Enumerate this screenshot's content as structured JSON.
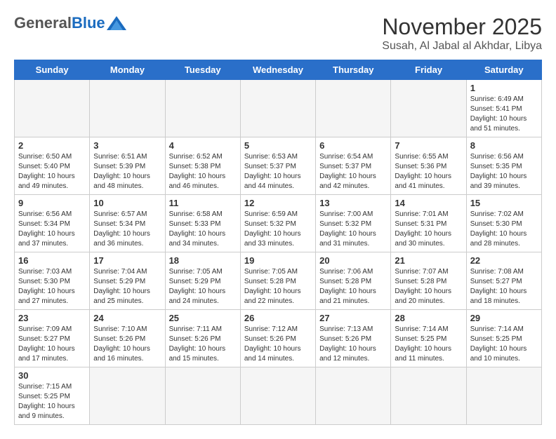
{
  "header": {
    "logo_general": "General",
    "logo_blue": "Blue",
    "month_title": "November 2025",
    "location": "Susah, Al Jabal al Akhdar, Libya"
  },
  "weekdays": [
    "Sunday",
    "Monday",
    "Tuesday",
    "Wednesday",
    "Thursday",
    "Friday",
    "Saturday"
  ],
  "days": [
    {
      "date": 1,
      "sunrise": "6:49 AM",
      "sunset": "5:41 PM",
      "daylight": "10 hours and 51 minutes."
    },
    {
      "date": 2,
      "sunrise": "6:50 AM",
      "sunset": "5:40 PM",
      "daylight": "10 hours and 49 minutes."
    },
    {
      "date": 3,
      "sunrise": "6:51 AM",
      "sunset": "5:39 PM",
      "daylight": "10 hours and 48 minutes."
    },
    {
      "date": 4,
      "sunrise": "6:52 AM",
      "sunset": "5:38 PM",
      "daylight": "10 hours and 46 minutes."
    },
    {
      "date": 5,
      "sunrise": "6:53 AM",
      "sunset": "5:37 PM",
      "daylight": "10 hours and 44 minutes."
    },
    {
      "date": 6,
      "sunrise": "6:54 AM",
      "sunset": "5:37 PM",
      "daylight": "10 hours and 42 minutes."
    },
    {
      "date": 7,
      "sunrise": "6:55 AM",
      "sunset": "5:36 PM",
      "daylight": "10 hours and 41 minutes."
    },
    {
      "date": 8,
      "sunrise": "6:56 AM",
      "sunset": "5:35 PM",
      "daylight": "10 hours and 39 minutes."
    },
    {
      "date": 9,
      "sunrise": "6:56 AM",
      "sunset": "5:34 PM",
      "daylight": "10 hours and 37 minutes."
    },
    {
      "date": 10,
      "sunrise": "6:57 AM",
      "sunset": "5:34 PM",
      "daylight": "10 hours and 36 minutes."
    },
    {
      "date": 11,
      "sunrise": "6:58 AM",
      "sunset": "5:33 PM",
      "daylight": "10 hours and 34 minutes."
    },
    {
      "date": 12,
      "sunrise": "6:59 AM",
      "sunset": "5:32 PM",
      "daylight": "10 hours and 33 minutes."
    },
    {
      "date": 13,
      "sunrise": "7:00 AM",
      "sunset": "5:32 PM",
      "daylight": "10 hours and 31 minutes."
    },
    {
      "date": 14,
      "sunrise": "7:01 AM",
      "sunset": "5:31 PM",
      "daylight": "10 hours and 30 minutes."
    },
    {
      "date": 15,
      "sunrise": "7:02 AM",
      "sunset": "5:30 PM",
      "daylight": "10 hours and 28 minutes."
    },
    {
      "date": 16,
      "sunrise": "7:03 AM",
      "sunset": "5:30 PM",
      "daylight": "10 hours and 27 minutes."
    },
    {
      "date": 17,
      "sunrise": "7:04 AM",
      "sunset": "5:29 PM",
      "daylight": "10 hours and 25 minutes."
    },
    {
      "date": 18,
      "sunrise": "7:05 AM",
      "sunset": "5:29 PM",
      "daylight": "10 hours and 24 minutes."
    },
    {
      "date": 19,
      "sunrise": "7:05 AM",
      "sunset": "5:28 PM",
      "daylight": "10 hours and 22 minutes."
    },
    {
      "date": 20,
      "sunrise": "7:06 AM",
      "sunset": "5:28 PM",
      "daylight": "10 hours and 21 minutes."
    },
    {
      "date": 21,
      "sunrise": "7:07 AM",
      "sunset": "5:28 PM",
      "daylight": "10 hours and 20 minutes."
    },
    {
      "date": 22,
      "sunrise": "7:08 AM",
      "sunset": "5:27 PM",
      "daylight": "10 hours and 18 minutes."
    },
    {
      "date": 23,
      "sunrise": "7:09 AM",
      "sunset": "5:27 PM",
      "daylight": "10 hours and 17 minutes."
    },
    {
      "date": 24,
      "sunrise": "7:10 AM",
      "sunset": "5:26 PM",
      "daylight": "10 hours and 16 minutes."
    },
    {
      "date": 25,
      "sunrise": "7:11 AM",
      "sunset": "5:26 PM",
      "daylight": "10 hours and 15 minutes."
    },
    {
      "date": 26,
      "sunrise": "7:12 AM",
      "sunset": "5:26 PM",
      "daylight": "10 hours and 14 minutes."
    },
    {
      "date": 27,
      "sunrise": "7:13 AM",
      "sunset": "5:26 PM",
      "daylight": "10 hours and 12 minutes."
    },
    {
      "date": 28,
      "sunrise": "7:14 AM",
      "sunset": "5:25 PM",
      "daylight": "10 hours and 11 minutes."
    },
    {
      "date": 29,
      "sunrise": "7:14 AM",
      "sunset": "5:25 PM",
      "daylight": "10 hours and 10 minutes."
    },
    {
      "date": 30,
      "sunrise": "7:15 AM",
      "sunset": "5:25 PM",
      "daylight": "10 hours and 9 minutes."
    }
  ],
  "labels": {
    "sunrise": "Sunrise:",
    "sunset": "Sunset:",
    "daylight": "Daylight:"
  }
}
